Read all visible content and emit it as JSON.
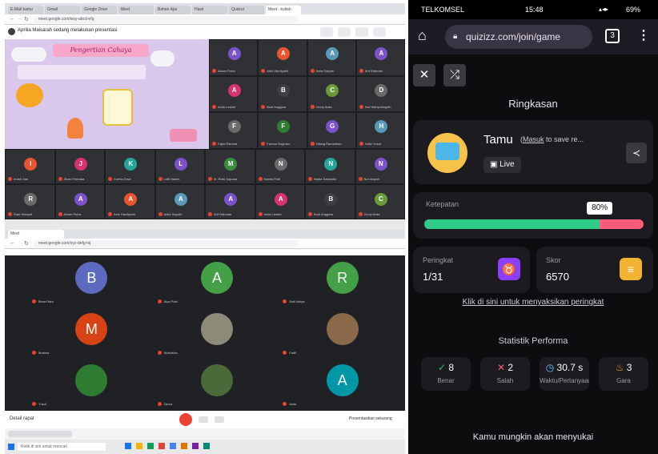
{
  "meet_top": {
    "tabs": [
      "E-Mail kamu",
      "Gmail",
      "Google Drive",
      "Meet",
      "Bahan Ajar",
      "Hasil",
      "Quizizz",
      "Meet - kuliah"
    ],
    "url": "meet.google.com/wxy-abcd-efg",
    "meeting_title": "Aprilia Maisarah sedang melakukan presentasi",
    "slide_title": "Pengertian Cahaya",
    "participants": [
      {
        "initial": "A",
        "color": "#7b52c9",
        "name": "Alvian Putra"
      },
      {
        "initial": "A",
        "color": "#e8542f",
        "name": "Anis Hardiyanti"
      },
      {
        "initial": "A",
        "color": "#5a9ab8",
        "name": "Anita Saputri"
      },
      {
        "initial": "A",
        "color": "#7b52c9",
        "name": "Arif Rahman"
      },
      {
        "initial": "A",
        "color": "#d8336c",
        "name": "Aulia Lestari"
      },
      {
        "initial": "B",
        "color": "#3c4043",
        "name": "Budi Anggara"
      },
      {
        "initial": "C",
        "color": "#6a9a3a",
        "name": "Cindy Aulia"
      },
      {
        "initial": "D",
        "color": "#6a6a6a",
        "name": "Dwi Wahyuningsih"
      },
      {
        "initial": "F",
        "color": "#6a6a6a",
        "name": "Fajar Rahmat"
      },
      {
        "initial": "F",
        "color": "#2e7d32",
        "name": "Farhan Nugroho"
      },
      {
        "initial": "G",
        "color": "#7b52c9",
        "name": "Gilang Ramadhan"
      },
      {
        "initial": "H",
        "color": "#5a9ab8",
        "name": "Hafiz Yusuf"
      },
      {
        "initial": "I",
        "color": "#e8542f",
        "name": "Indah Sari"
      },
      {
        "initial": "J",
        "color": "#d8336c",
        "name": "Jihan Permata"
      },
      {
        "initial": "K",
        "color": "#26a69a",
        "name": "Kurnia Dewi"
      },
      {
        "initial": "L",
        "color": "#7b52c9",
        "name": "Lutfi Hakim"
      },
      {
        "initial": "M",
        "color": "#388e3c",
        "name": "M. Rizki Saputra"
      },
      {
        "initial": "N",
        "color": "#6a6a6a",
        "name": "Nabila Putri"
      },
      {
        "initial": "N",
        "color": "#26a69a",
        "name": "Nadia Salsabila"
      },
      {
        "initial": "N",
        "color": "#7b52c9",
        "name": "Nur Aisyah"
      },
      {
        "initial": "R",
        "color": "#6a6a6a",
        "name": "Rian Hidayat"
      }
    ]
  },
  "meet_bottom": {
    "url": "meet.google.com/xyz-defg-hij",
    "participants": [
      {
        "initial": "B",
        "color": "#5c6bc0",
        "name": "Bima Rafa"
      },
      {
        "initial": "A",
        "color": "#43a047",
        "name": "Alya Putri"
      },
      {
        "initial": "R",
        "color": "#43a047",
        "name": "Rafi Aditya"
      },
      {
        "initial": "M",
        "color": "#d84315",
        "name": "Mutiara"
      },
      {
        "initial": "",
        "color": "#8d8a7a",
        "name": "Nurhaliza"
      },
      {
        "initial": "",
        "color": "#8a6a4a",
        "name": "Fadli"
      },
      {
        "initial": "",
        "color": "#2e7d32",
        "name": "Yusuf"
      },
      {
        "initial": "",
        "color": "#4a6a3a",
        "name": "Zahra"
      },
      {
        "initial": "A",
        "color": "#0097a7",
        "name": "Azka"
      }
    ],
    "controls": {
      "left_label": "Detail rapat",
      "right_label": "Presentasikan sekarang"
    },
    "taskbar_search": "Ketik di sini untuk mencari"
  },
  "phone": {
    "status": {
      "carrier": "TELKOMSEL",
      "time": "15:48",
      "battery": "69%"
    },
    "url": "quizizz.com/join/game",
    "tabs_count": "3",
    "summary_title": "Ringkasan",
    "player": {
      "name": "Tamu",
      "login_link": "Masuk",
      "login_suffix": "to save re...",
      "mode": "Live"
    },
    "accuracy": {
      "label": "Ketepatan",
      "percent_label": "80%",
      "value": 0.8
    },
    "rank": {
      "label": "Peringkat",
      "value": "1/31"
    },
    "score": {
      "label": "Skor",
      "value": "6570"
    },
    "leaderboard_link": "Klik di sini untuk menyaksikan peringkat",
    "performance_title": "Statistik Performa",
    "stats": [
      {
        "icon": "check-icon",
        "value": "8",
        "label": "Benar",
        "color": "#27c27a"
      },
      {
        "icon": "cross-icon",
        "value": "2",
        "label": "Salah",
        "color": "#ff5c7a"
      },
      {
        "icon": "timer-icon",
        "value": "30.7 s",
        "label": "Waktu/Pertanyaan",
        "color": "#6ac6ff"
      },
      {
        "icon": "fire-icon",
        "value": "3",
        "label": "Gara",
        "color": "#ff9f1a"
      }
    ],
    "footer_text": "Kamu mungkin akan menyukai",
    "colors": {
      "correct": "#2ecc86",
      "wrong": "#ff5c7a",
      "accent": "#8a3ffc",
      "score": "#f2b233"
    }
  }
}
